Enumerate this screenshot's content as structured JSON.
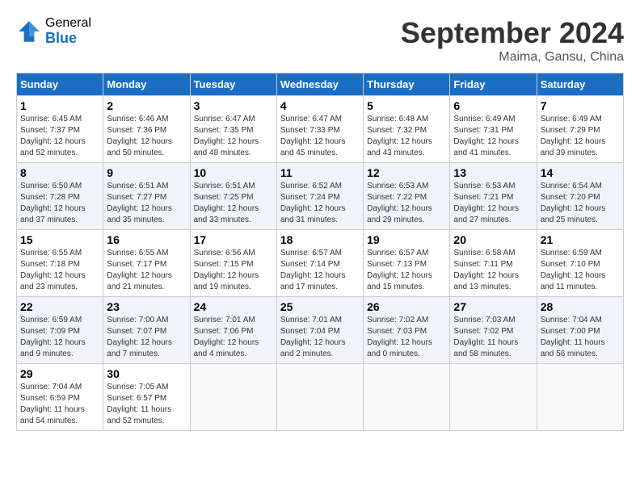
{
  "header": {
    "logo_general": "General",
    "logo_blue": "Blue",
    "month_title": "September 2024",
    "location": "Maima, Gansu, China"
  },
  "days_of_week": [
    "Sunday",
    "Monday",
    "Tuesday",
    "Wednesday",
    "Thursday",
    "Friday",
    "Saturday"
  ],
  "weeks": [
    [
      {
        "day": "1",
        "sunrise": "6:45 AM",
        "sunset": "7:37 PM",
        "daylight": "12 hours and 52 minutes."
      },
      {
        "day": "2",
        "sunrise": "6:46 AM",
        "sunset": "7:36 PM",
        "daylight": "12 hours and 50 minutes."
      },
      {
        "day": "3",
        "sunrise": "6:47 AM",
        "sunset": "7:35 PM",
        "daylight": "12 hours and 48 minutes."
      },
      {
        "day": "4",
        "sunrise": "6:47 AM",
        "sunset": "7:33 PM",
        "daylight": "12 hours and 45 minutes."
      },
      {
        "day": "5",
        "sunrise": "6:48 AM",
        "sunset": "7:32 PM",
        "daylight": "12 hours and 43 minutes."
      },
      {
        "day": "6",
        "sunrise": "6:49 AM",
        "sunset": "7:31 PM",
        "daylight": "12 hours and 41 minutes."
      },
      {
        "day": "7",
        "sunrise": "6:49 AM",
        "sunset": "7:29 PM",
        "daylight": "12 hours and 39 minutes."
      }
    ],
    [
      {
        "day": "8",
        "sunrise": "6:50 AM",
        "sunset": "7:28 PM",
        "daylight": "12 hours and 37 minutes."
      },
      {
        "day": "9",
        "sunrise": "6:51 AM",
        "sunset": "7:27 PM",
        "daylight": "12 hours and 35 minutes."
      },
      {
        "day": "10",
        "sunrise": "6:51 AM",
        "sunset": "7:25 PM",
        "daylight": "12 hours and 33 minutes."
      },
      {
        "day": "11",
        "sunrise": "6:52 AM",
        "sunset": "7:24 PM",
        "daylight": "12 hours and 31 minutes."
      },
      {
        "day": "12",
        "sunrise": "6:53 AM",
        "sunset": "7:22 PM",
        "daylight": "12 hours and 29 minutes."
      },
      {
        "day": "13",
        "sunrise": "6:53 AM",
        "sunset": "7:21 PM",
        "daylight": "12 hours and 27 minutes."
      },
      {
        "day": "14",
        "sunrise": "6:54 AM",
        "sunset": "7:20 PM",
        "daylight": "12 hours and 25 minutes."
      }
    ],
    [
      {
        "day": "15",
        "sunrise": "6:55 AM",
        "sunset": "7:18 PM",
        "daylight": "12 hours and 23 minutes."
      },
      {
        "day": "16",
        "sunrise": "6:55 AM",
        "sunset": "7:17 PM",
        "daylight": "12 hours and 21 minutes."
      },
      {
        "day": "17",
        "sunrise": "6:56 AM",
        "sunset": "7:15 PM",
        "daylight": "12 hours and 19 minutes."
      },
      {
        "day": "18",
        "sunrise": "6:57 AM",
        "sunset": "7:14 PM",
        "daylight": "12 hours and 17 minutes."
      },
      {
        "day": "19",
        "sunrise": "6:57 AM",
        "sunset": "7:13 PM",
        "daylight": "12 hours and 15 minutes."
      },
      {
        "day": "20",
        "sunrise": "6:58 AM",
        "sunset": "7:11 PM",
        "daylight": "12 hours and 13 minutes."
      },
      {
        "day": "21",
        "sunrise": "6:59 AM",
        "sunset": "7:10 PM",
        "daylight": "12 hours and 11 minutes."
      }
    ],
    [
      {
        "day": "22",
        "sunrise": "6:59 AM",
        "sunset": "7:09 PM",
        "daylight": "12 hours and 9 minutes."
      },
      {
        "day": "23",
        "sunrise": "7:00 AM",
        "sunset": "7:07 PM",
        "daylight": "12 hours and 7 minutes."
      },
      {
        "day": "24",
        "sunrise": "7:01 AM",
        "sunset": "7:06 PM",
        "daylight": "12 hours and 4 minutes."
      },
      {
        "day": "25",
        "sunrise": "7:01 AM",
        "sunset": "7:04 PM",
        "daylight": "12 hours and 2 minutes."
      },
      {
        "day": "26",
        "sunrise": "7:02 AM",
        "sunset": "7:03 PM",
        "daylight": "12 hours and 0 minutes."
      },
      {
        "day": "27",
        "sunrise": "7:03 AM",
        "sunset": "7:02 PM",
        "daylight": "11 hours and 58 minutes."
      },
      {
        "day": "28",
        "sunrise": "7:04 AM",
        "sunset": "7:00 PM",
        "daylight": "11 hours and 56 minutes."
      }
    ],
    [
      {
        "day": "29",
        "sunrise": "7:04 AM",
        "sunset": "6:59 PM",
        "daylight": "11 hours and 54 minutes."
      },
      {
        "day": "30",
        "sunrise": "7:05 AM",
        "sunset": "6:57 PM",
        "daylight": "11 hours and 52 minutes."
      },
      null,
      null,
      null,
      null,
      null
    ]
  ]
}
